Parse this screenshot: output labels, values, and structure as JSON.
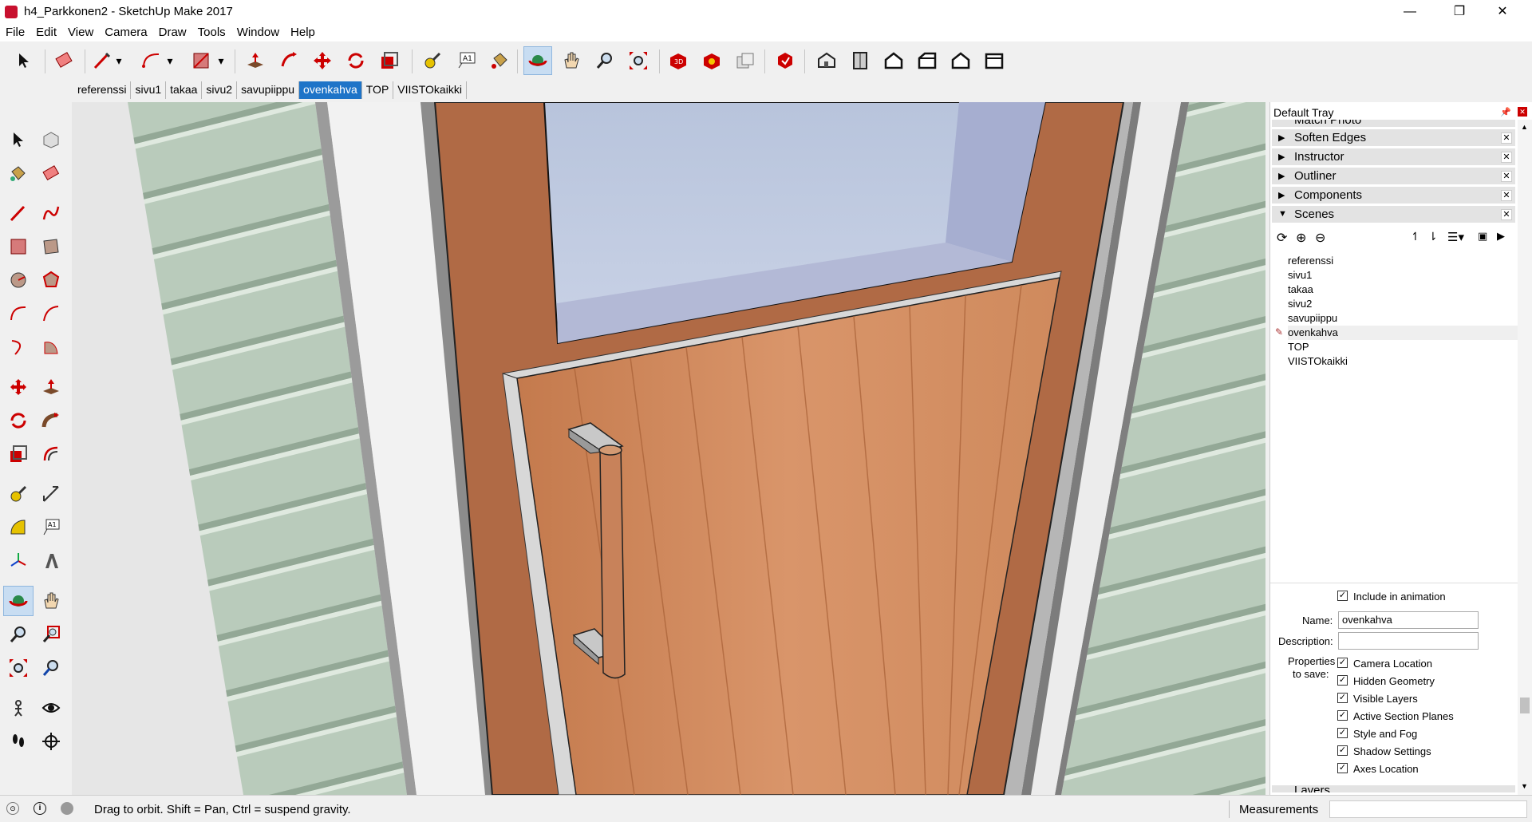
{
  "window": {
    "title": "h4_Parkkonen2 - SketchUp Make 2017",
    "minimize_glyph": "—",
    "restore_glyph": "❐",
    "close_glyph": "✕"
  },
  "menu": {
    "file": "File",
    "edit": "Edit",
    "view": "View",
    "camera": "Camera",
    "draw": "Draw",
    "tools": "Tools",
    "window": "Window",
    "help": "Help"
  },
  "scene_tabs": {
    "t0": "referenssi",
    "t1": "sivu1",
    "t2": "takaa",
    "t3": "sivu2",
    "t4": "savupiippu",
    "t5": "ovenkahva",
    "t6": "TOP",
    "t7": "VIISTOkaikki"
  },
  "tray": {
    "title": "Default Tray",
    "collapsed_top": "Match Photo",
    "panels": {
      "soften_edges": "Soften Edges",
      "instructor": "Instructor",
      "outliner": "Outliner",
      "components": "Components",
      "scenes": "Scenes"
    },
    "scene_list": {
      "s0": "referenssi",
      "s1": "sivu1",
      "s2": "takaa",
      "s3": "sivu2",
      "s4": "savupiippu",
      "s5": "ovenkahva",
      "s6": "TOP",
      "s7": "VIISTOkaikki"
    },
    "properties": {
      "include_animation": "Include in animation",
      "name_label": "Name:",
      "name_value": "ovenkahva",
      "description_label": "Description:",
      "description_value": "",
      "props_label_1": "Properties",
      "props_label_2": "to save:",
      "camera_location": "Camera Location",
      "hidden_geometry": "Hidden Geometry",
      "visible_layers": "Visible Layers",
      "active_section_planes": "Active Section Planes",
      "style_and_fog": "Style and Fog",
      "shadow_settings": "Shadow Settings",
      "axes_location": "Axes Location"
    },
    "collapsed_bottom": "Layers"
  },
  "status": {
    "message": "Drag to orbit. Shift = Pan, Ctrl = suspend gravity.",
    "measurements_label": "Measurements",
    "measurements_value": ""
  },
  "colors": {
    "accent": "#1e74c8",
    "door_wood": "#c98356",
    "frame_brown": "#b06a45",
    "siding_green": "#b6c9b8"
  }
}
